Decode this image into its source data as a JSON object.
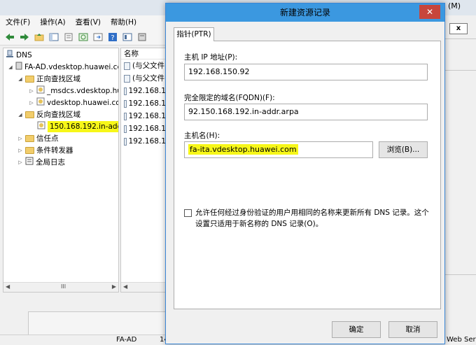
{
  "bg_window": {
    "title_controls": [
      "(M)",
      "☐"
    ],
    "menu": [
      "文件(F)",
      "操作(A)",
      "查看(V)",
      "帮助(H)"
    ],
    "tree": [
      {
        "label": "DNS",
        "level": 0
      },
      {
        "label": "FA-AD.vdesktop.huawei.cc",
        "level": 1
      },
      {
        "label": "正向查找区域",
        "level": 2
      },
      {
        "label": "_msdcs.vdesktop.hu",
        "level": 3
      },
      {
        "label": "vdesktop.huawei.co",
        "level": 3
      },
      {
        "label": "反向查找区域",
        "level": 2
      },
      {
        "label": "150.168.192.in-add",
        "level": 3,
        "highlighted": true
      },
      {
        "label": "信任点",
        "level": 2
      },
      {
        "label": "条件转发器",
        "level": 2
      },
      {
        "label": "全局日志",
        "level": 2
      }
    ],
    "list_header": "名称",
    "list_rows": [
      "(与父文件",
      "(与父文件",
      "192.168.1",
      "192.168.1",
      "192.168.1",
      "192.168.1",
      "192.168.1"
    ],
    "scroll_mid": "III",
    "status": {
      "server": "FA-AD",
      "num": "14"
    },
    "right_window": {
      "label": "(M)",
      "close": "x",
      "bottom_text": "Web Ser"
    }
  },
  "dialog": {
    "title": "新建资源记录",
    "close": "✕",
    "tab": "指针(PTR)",
    "host_ip_label": "主机 IP 地址(P):",
    "host_ip_value": "192.168.150.92",
    "fqdn_label": "完全限定的域名(FQDN)(F):",
    "fqdn_value": "92.150.168.192.in-addr.arpa",
    "hostname_label": "主机名(H):",
    "hostname_value": "fa-ita.vdesktop.huawei.com",
    "browse_button": "浏览(B)...",
    "checkbox_label": "允许任何经过身份验证的用户用相同的名称来更新所有 DNS 记录。这个设置只适用于新名称的 DNS 记录(O)。",
    "ok_button": "确定",
    "cancel_button": "取消"
  },
  "colors": {
    "highlight": "#f7f719",
    "title_accent": "#3b98e0",
    "close_red": "#c7463c"
  }
}
